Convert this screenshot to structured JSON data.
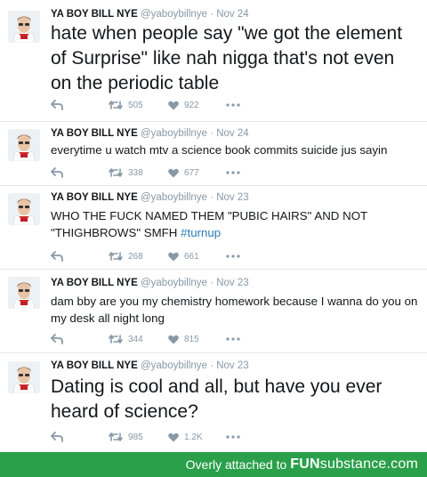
{
  "tweets": [
    {
      "name": "YA BOY BILL NYE",
      "handle": "@yaboybillnye",
      "separator": "·",
      "date": "Nov 24",
      "text": "hate when people say \"we got the element of Surprise\" like nah nigga that's not even on the periodic table",
      "hashtag": "",
      "retweets": "505",
      "likes": "922"
    },
    {
      "name": "YA BOY BILL NYE",
      "handle": "@yaboybillnye",
      "separator": "·",
      "date": "Nov 24",
      "text": "everytime u watch mtv a science book commits suicide jus sayin",
      "hashtag": "",
      "retweets": "338",
      "likes": "677"
    },
    {
      "name": "YA BOY BILL NYE",
      "handle": "@yaboybillnye",
      "separator": "·",
      "date": "Nov 23",
      "text": "WHO THE FUCK NAMED THEM \"PUBIC HAIRS\" AND NOT \"THIGHBROWS\" SMFH",
      "hashtag": "#turnup",
      "retweets": "268",
      "likes": "661"
    },
    {
      "name": "YA BOY BILL NYE",
      "handle": "@yaboybillnye",
      "separator": "·",
      "date": "Nov 23",
      "text": "dam bby are you my chemistry homework because I wanna do you on my desk all night long",
      "hashtag": "",
      "retweets": "344",
      "likes": "815"
    },
    {
      "name": "YA BOY BILL NYE",
      "handle": "@yaboybillnye",
      "separator": "·",
      "date": "Nov 23",
      "text": "Dating is cool and all, but have you ever heard of science?",
      "hashtag": "",
      "retweets": "985",
      "likes": "1.2K"
    }
  ],
  "footer": {
    "caption": "Overly attached to",
    "brand_fun": "FUN",
    "brand_substance": "substance",
    "brand_domain": ".com"
  },
  "colors": {
    "link": "#2b7bb9",
    "muted": "#8899a6",
    "footer_bg": "#2aa04a"
  },
  "icons": [
    "reply-icon",
    "retweet-icon",
    "heart-icon",
    "more-icon"
  ]
}
